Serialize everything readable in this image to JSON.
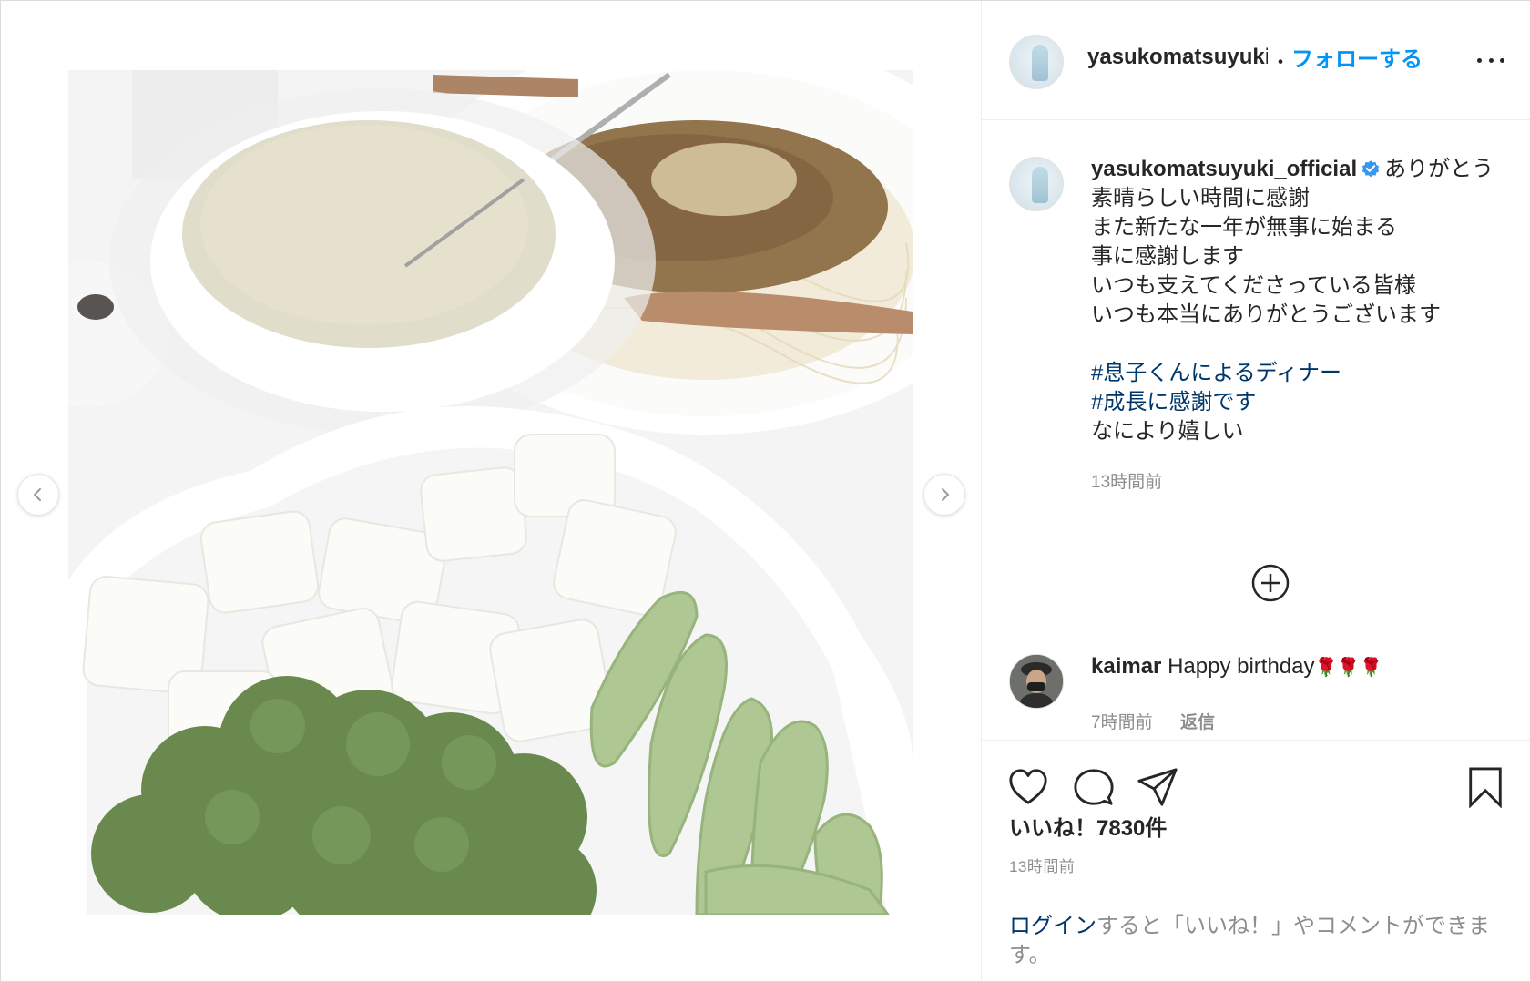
{
  "post": {
    "username": "yasukomatsuyuki_official",
    "username_truncated": "yasukomatsuyuki_",
    "separator": "・",
    "follow_label": "フォローする"
  },
  "caption": {
    "username": "yasukomatsuyuki_official",
    "line1": "ありがとう",
    "line2": "素晴らしい時間に感謝",
    "line3": "また新たな一年が無事に始まる",
    "line4": "事に感謝します",
    "line5": "いつも支えてくださっている皆様",
    "line6": "いつも本当にありがとうございます",
    "hashtag1": "#息子くんによるディナー",
    "hashtag2": "#成長に感謝です",
    "line7": "なにより嬉しい",
    "time": "13時間前"
  },
  "comment": {
    "username": "kaimar",
    "text": "Happy birthday",
    "emoji": "🌹🌹🌹",
    "time": "7時間前",
    "reply_label": "返信"
  },
  "actions": {
    "likes": "いいね！7830件",
    "time": "13時間前"
  },
  "login": {
    "link_label": "ログイン",
    "rest": "すると「いいね！」やコメントができます。"
  },
  "icons": {
    "prev": "chevron-left-icon",
    "next": "chevron-right-icon",
    "more": "more-icon",
    "verified": "verified-badge-icon",
    "load_more": "plus-circle-icon",
    "like": "heart-icon",
    "comment": "comment-icon",
    "share": "paper-plane-icon",
    "save": "bookmark-icon"
  },
  "colors": {
    "accent": "#0095f6",
    "hashtag": "#00376b",
    "muted": "#8e8e8e",
    "text": "#262626"
  }
}
